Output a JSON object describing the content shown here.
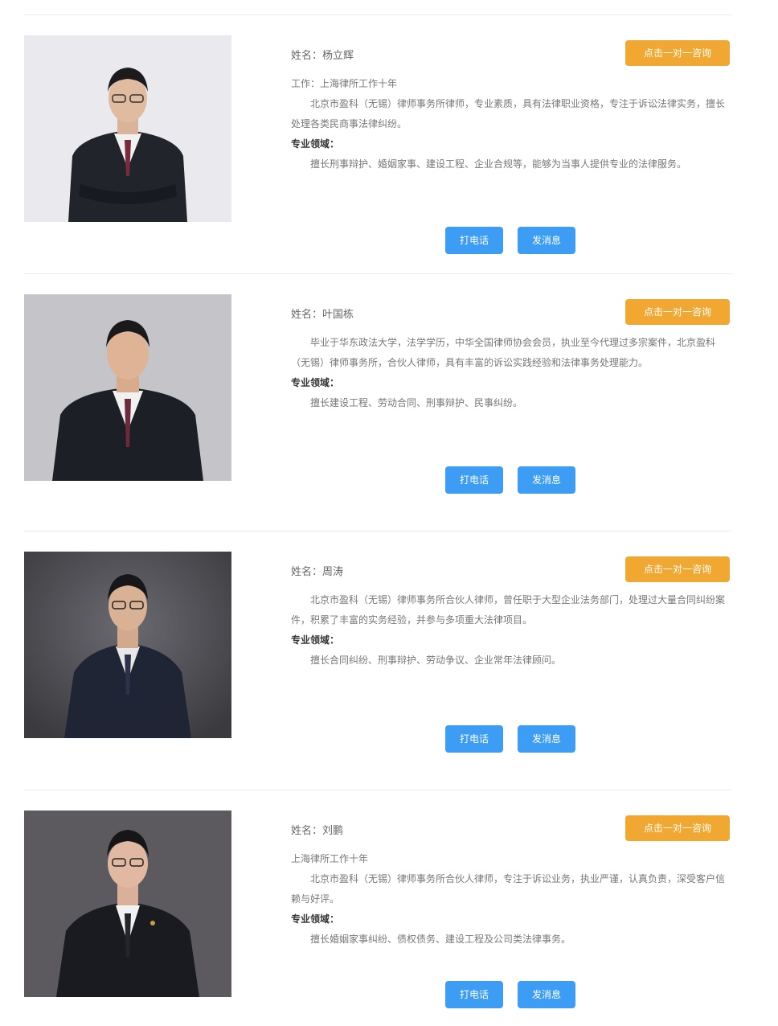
{
  "lawyers": [
    {
      "name_line": "姓名：杨立辉",
      "consult_label": "点击一对一咨询",
      "firm_line": "工作：上海律所工作十年",
      "bio": "北京市盈科（无锡）律师事务所律师，专业素质，具有法律职业资格，专注于诉讼法律实务，擅长处理各类民商事法律纠纷。",
      "field_label": "专业领域：",
      "fields": "擅长刑事辩护、婚姻家事、建设工程、企业合规等，能够为当事人提供专业的法律服务。",
      "phone_label": "打电话",
      "message_label": "发消息",
      "photo_theme": "light"
    },
    {
      "name_line": "姓名：叶国栋",
      "consult_label": "点击一对一咨询",
      "firm_line": "",
      "bio": "毕业于华东政法大学，法学学历，中华全国律师协会会员，执业至今代理过多宗案件，北京盈科（无锡）律师事务所，合伙人律师，具有丰富的诉讼实践经验和法律事务处理能力。",
      "field_label": "专业领域：",
      "fields": "擅长建设工程、劳动合同、刑事辩护、民事纠纷。",
      "phone_label": "打电话",
      "message_label": "发消息",
      "photo_theme": "grey"
    },
    {
      "name_line": "姓名：周涛",
      "consult_label": "点击一对一咨询",
      "firm_line": "",
      "bio": "北京市盈科（无锡）律师事务所合伙人律师，曾任职于大型企业法务部门，处理过大量合同纠纷案件，积累了丰富的实务经验，并参与多项重大法律项目。",
      "field_label": "专业领域：",
      "fields": "擅长合同纠纷、刑事辩护、劳动争议、企业常年法律顾问。",
      "phone_label": "打电话",
      "message_label": "发消息",
      "photo_theme": "dark"
    },
    {
      "name_line": "姓名：刘鹏",
      "consult_label": "点击一对一咨询",
      "firm_line": "上海律所工作十年",
      "bio": "北京市盈科（无锡）律师事务所合伙人律师，专注于诉讼业务，执业严谨，认真负责，深受客户信赖与好评。",
      "field_label": "专业领域：",
      "fields": "擅长婚姻家事纠纷、债权债务、建设工程及公司类法律事务。",
      "phone_label": "打电话",
      "message_label": "发消息",
      "photo_theme": "dark"
    }
  ],
  "colors": {
    "consult_button": "#f0a832",
    "action_button": "#3d9df5",
    "divider": "#ebebeb"
  }
}
